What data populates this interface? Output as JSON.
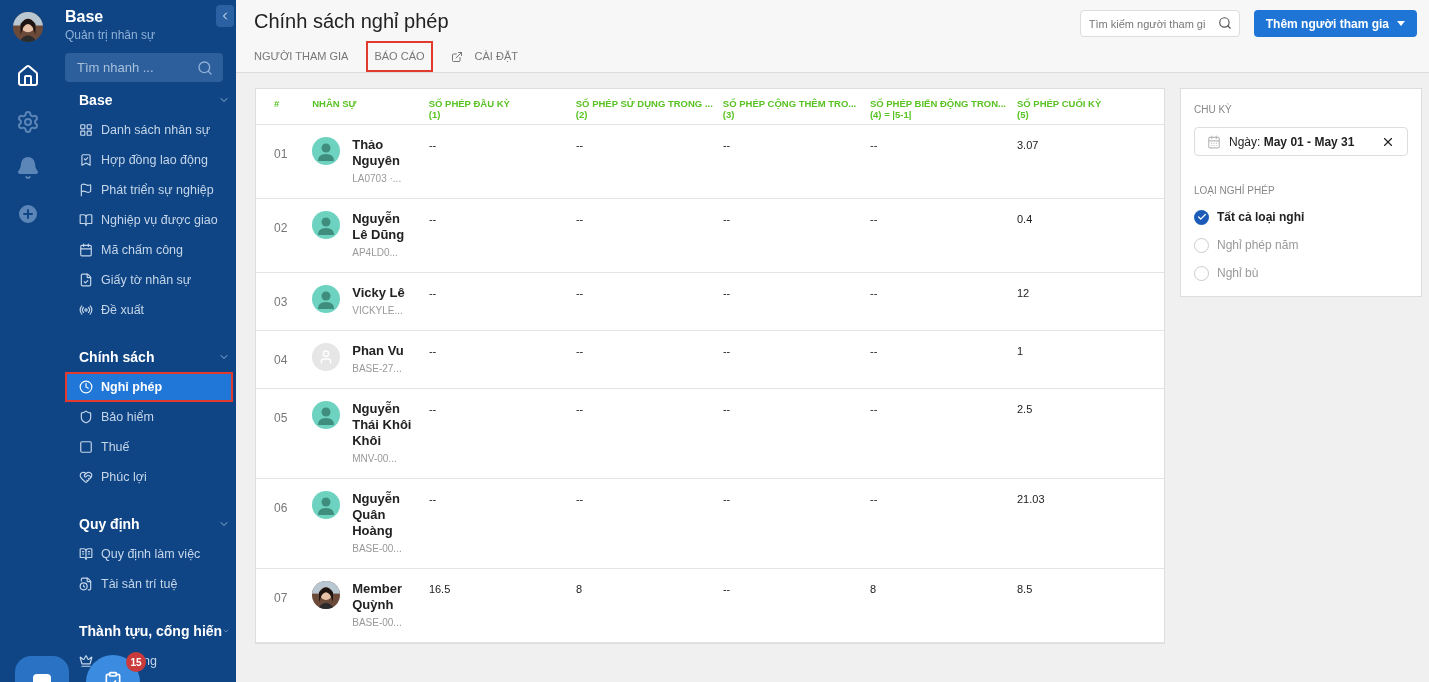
{
  "sidebar": {
    "brand": "Base",
    "subtitle": "Quản trị nhân sự",
    "search": {
      "placeholder": "Tìm nhanh ..."
    },
    "sections": [
      {
        "title": "Base",
        "items": [
          {
            "label": "Danh sách nhân sự",
            "selected": false,
            "annotated": false
          },
          {
            "label": "Hợp đồng lao động",
            "selected": false,
            "annotated": false
          },
          {
            "label": "Phát triển sự nghiệp",
            "selected": false,
            "annotated": false
          },
          {
            "label": "Nghiệp vụ được giao",
            "selected": false,
            "annotated": false
          },
          {
            "label": "Mã chấm công",
            "selected": false,
            "annotated": false
          },
          {
            "label": "Giấy tờ nhân sự",
            "selected": false,
            "annotated": false
          },
          {
            "label": "Đề xuất",
            "selected": false,
            "annotated": false
          }
        ]
      },
      {
        "title": "Chính sách",
        "items": [
          {
            "label": "Nghỉ phép",
            "selected": true,
            "annotated": true
          },
          {
            "label": "Bảo hiểm",
            "selected": false,
            "annotated": false
          },
          {
            "label": "Thuế",
            "selected": false,
            "annotated": false
          },
          {
            "label": "Phúc lợi",
            "selected": false,
            "annotated": false
          }
        ]
      },
      {
        "title": "Quy định",
        "items": [
          {
            "label": "Quy định làm việc",
            "selected": false,
            "annotated": false
          },
          {
            "label": "Tài sản trí tuệ",
            "selected": false,
            "annotated": false
          }
        ]
      },
      {
        "title": "Thành tựu, cống hiến",
        "items": [
          {
            "label": "ng",
            "selected": false,
            "annotated": false
          }
        ]
      }
    ],
    "badge": "15"
  },
  "header": {
    "title": "Chính sách nghỉ phép",
    "tabs": [
      {
        "label": "NGƯỜI THAM GIA",
        "selected": false,
        "annotated": false,
        "kind": "plain"
      },
      {
        "label": "BÁO CÁO",
        "selected": false,
        "annotated": true,
        "kind": "plain"
      },
      {
        "label": "CÀI ĐẶT",
        "selected": false,
        "annotated": false,
        "kind": "link"
      }
    ],
    "search": {
      "placeholder": "Tìm kiếm người tham gi"
    },
    "button": "Thêm người tham gia"
  },
  "table": {
    "columns": [
      [
        "#"
      ],
      [
        "NHÂN SỰ"
      ],
      [
        "SỐ PHÉP ĐẦU KỲ",
        "(1)"
      ],
      [
        "SỐ PHÉP SỬ DỤNG TRONG ...",
        "(2)"
      ],
      [
        "SỐ PHÉP CỘNG THÊM TRO...",
        "(3)"
      ],
      [
        "SỐ PHÉP BIẾN ĐỘNG TRON...",
        "(4) = |5-1|"
      ],
      [
        "SỐ PHÉP CUỐI KỲ",
        "(5)"
      ]
    ],
    "rows": [
      {
        "index": "01",
        "name": "Thảo Nguyên",
        "code": "LA0703 ·...",
        "kind": "default",
        "values": [
          "--",
          "--",
          "--",
          "--",
          "3.07"
        ]
      },
      {
        "index": "02",
        "name": "Nguyễn Lê Dũng",
        "code": "AP4LD0...",
        "kind": "default",
        "values": [
          "--",
          "--",
          "--",
          "--",
          "0.4"
        ]
      },
      {
        "index": "03",
        "name": "Vicky Lê",
        "code": "VICKYLE...",
        "kind": "default",
        "values": [
          "--",
          "--",
          "--",
          "--",
          "12"
        ]
      },
      {
        "index": "04",
        "name": "Phan Vu",
        "code": "BASE-27...",
        "kind": "empty",
        "values": [
          "--",
          "--",
          "--",
          "--",
          "1"
        ]
      },
      {
        "index": "05",
        "name": "Nguyễn Thái Khôi Khôi",
        "code": "MNV-00...",
        "kind": "default",
        "values": [
          "--",
          "--",
          "--",
          "--",
          "2.5"
        ]
      },
      {
        "index": "06",
        "name": "Nguyễn Quân Hoàng",
        "code": "BASE-00...",
        "kind": "default",
        "values": [
          "--",
          "--",
          "--",
          "--",
          "21.03"
        ]
      },
      {
        "index": "07",
        "name": "Member Quỳnh",
        "code": "BASE-00...",
        "values": [
          "16.5",
          "8",
          "--",
          "8",
          "8.5"
        ]
      }
    ]
  },
  "filters": {
    "period_label": "CHU KỲ",
    "period_prefix": "Ngày:",
    "period_value": "May 01 - May 31",
    "type_label": "LOẠI NGHỈ PHÉP",
    "types": [
      {
        "label": "Tất cả loại nghỉ",
        "selected": true
      },
      {
        "label": "Nghỉ phép năm",
        "selected": false
      },
      {
        "label": "Nghỉ bù",
        "selected": false
      }
    ]
  }
}
